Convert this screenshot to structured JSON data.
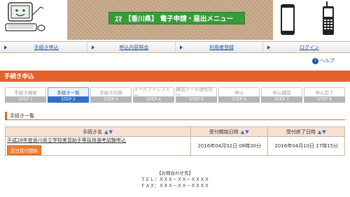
{
  "header": {
    "banner_logo": "ｽﾏ",
    "banner_title": "【香川県】 電子申請・届出メニュー"
  },
  "nav": {
    "items": [
      {
        "label": "手続き申込"
      },
      {
        "label": "申込内容照会"
      },
      {
        "label": "利用者登録"
      },
      {
        "label": "ログイン"
      }
    ]
  },
  "help": {
    "label": "ヘルプ",
    "icon": "?"
  },
  "section": {
    "title": "手続き申込"
  },
  "steps": [
    {
      "label": "手続き検索",
      "num": "STEP 1"
    },
    {
      "label": "手続き一覧",
      "num": "STEP 2"
    },
    {
      "label": "手続き内容",
      "num": "STEP 3"
    },
    {
      "label": "メールアドレス入力",
      "num": "STEP 4"
    },
    {
      "label": "確認メール送信完了",
      "num": "STEP 5"
    },
    {
      "label": "申込",
      "num": "STEP 6"
    },
    {
      "label": "申込確認",
      "num": "STEP 7"
    },
    {
      "label": "申込完了",
      "num": "STEP 8"
    }
  ],
  "subhead": {
    "title": "手続き一覧"
  },
  "table": {
    "headers": {
      "name": "手続き名",
      "start": "受付開始日時",
      "end": "受付終了日時",
      "sort": "▲▼"
    },
    "rows": [
      {
        "name": "平成28年度香川県立学校実習助手等採用選考試験申込",
        "badge": "近日受付開始",
        "start": "2016年04月02日 08時30分",
        "end": "2016年04月10日 17時15分"
      }
    ]
  },
  "footer": {
    "lines": [
      "【お問合わせ先】",
      "ＴＥＬ：ＸＸＸ－ＸＸ－ＸＸＸＸ",
      "ＦＡＸ：ＸＸＸ－ＸＸ－ＸＸＸＸ"
    ]
  }
}
